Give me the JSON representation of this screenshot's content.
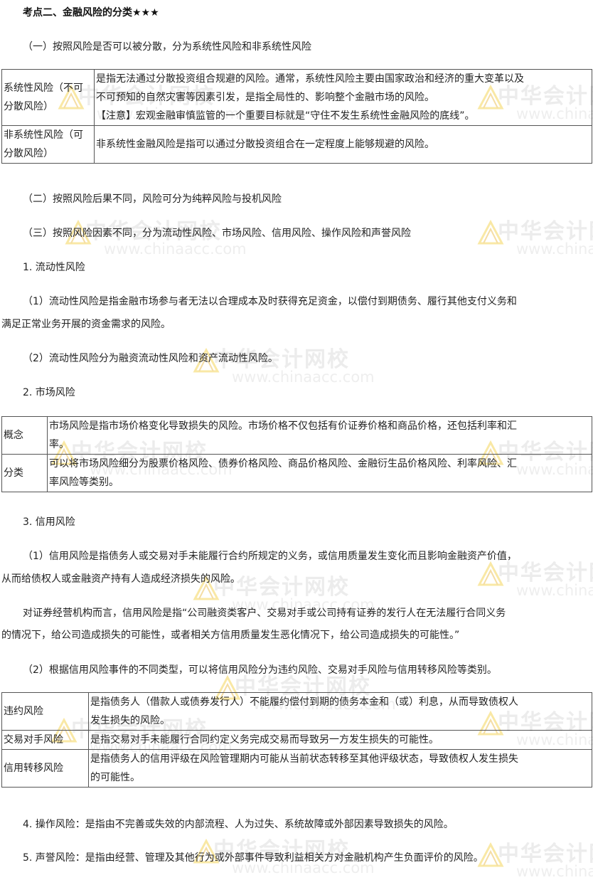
{
  "heading": "考点二、金融风险的分类★★★",
  "section1": "（一）按照风险是否可以被分散，分为系统性风险和非系统性风险",
  "table1": {
    "rows": [
      {
        "name": "系统性风险（不可分散风险）",
        "lines": [
          "是指无法通过分散投资组合规避的风险。通常，系统性风险主要由国家政治和经济的重大变革以及",
          "不可预知的自然灾害等因素引发，是指全局性的、影响整个金融市场的风险。",
          "【注意】宏观金融审慎监管的一个重要目标就是“守住不发生系统性金融风险的底线”。"
        ]
      },
      {
        "name": "非系统性风险（可分散风险）",
        "lines": [
          "非系统性金融风险是指可以通过分散投资组合在一定程度上能够规避的风险。"
        ]
      }
    ]
  },
  "section2": "（二）按照风险后果不同，风险可分为纯粹风险与投机风险",
  "section3": "（三）按照风险因素不同，分为流动性风险、市场风险、信用风险、操作风险和声誉风险",
  "item1": "1. 流动性风险",
  "item1_p1a": "（1）流动性风险是指金融市场参与者无法以合理成本及时获得充足资金，以偿付到期债务、履行其他支付义务和",
  "item1_p1b": "满足正常业务开展的资金需求的风险。",
  "item1_p2": "（2）流动性风险分为融资流动性风险和资产流动性风险。",
  "item2": "2. 市场风险",
  "table2": {
    "rows": [
      {
        "name": "概念",
        "lines": [
          "市场风险是指市场价格变化导致损失的风险。市场价格不仅包括有价证券价格和商品价格，还包括利率和汇",
          "率。"
        ]
      },
      {
        "name": "分类",
        "lines": [
          "可以将市场风险细分为股票价格风险、债券价格风险、商品价格风险、金融衍生品价格风险、利率风险、汇",
          "率风险等类别。"
        ]
      }
    ]
  },
  "item3": "3. 信用风险",
  "item3_p1a": "（1）信用风险是指债务人或交易对手未能履行合约所规定的义务，或信用质量发生变化而且影响金融资产价值，",
  "item3_p1b": "从而给债权人或金融资产持有人造成经济损失的风险。",
  "item3_p2a": "对证券经营机构而言，信用风险是指“公司融资类客户、交易对手或公司持有证券的发行人在无法履行合同义务",
  "item3_p2b": "的情况下，给公司造成损失的可能性，或者相关方信用质量发生恶化情况下，给公司造成损失的可能性。”",
  "item3_p3": "（2）根据信用风险事件的不同类型，可以将信用风险分为违约风险、交易对手风险与信用转移风险等类别。",
  "table3": {
    "rows": [
      {
        "name": "违约风险",
        "lines": [
          "是指债务人（借款人或债券发行人）不能履约偿付到期的债务本金和（或）利息，从而导致债权人",
          "发生损失的风险。"
        ]
      },
      {
        "name": "交易对手风险",
        "lines": [
          "是指交易对手未能履行合同约定义务完成交易而导致另一方发生损失的可能性。"
        ]
      },
      {
        "name": "信用转移风险",
        "lines": [
          "是指债务人的信用评级在风险管理期内可能从当前状态转移至其他评级状态，导致债权人发生损失",
          "的可能性。"
        ]
      }
    ]
  },
  "item4": "4. 操作风险：是指由不完善或失效的内部流程、人为过失、系统故障或外部因素导致损失的风险。",
  "item5": "5. 声誉风险：是指由经营、管理及其他行为或外部事件导致利益相关方对金融机构产生负面评价的风险。",
  "watermark": {
    "cn": "中华会计网校",
    "en": "www.chinaacc.com"
  }
}
